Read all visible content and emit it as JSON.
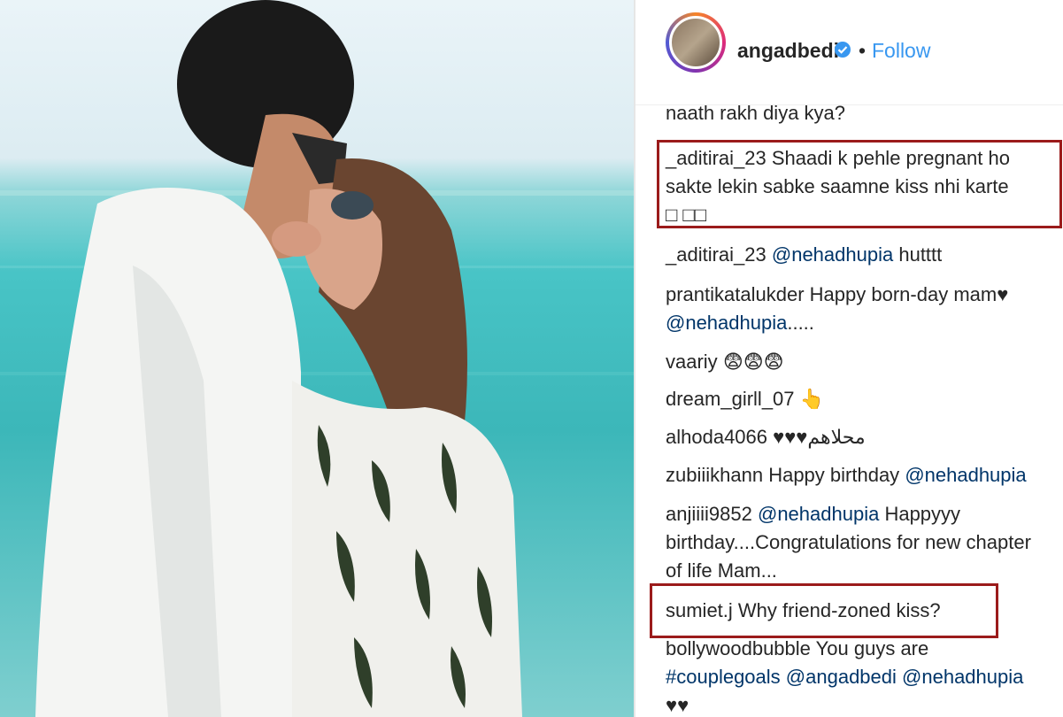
{
  "post": {
    "username": "angadbedi",
    "separator": "•",
    "follow_label": "Follow"
  },
  "comments": [
    {
      "text": "naath rakh diya kya?"
    },
    {
      "user": "_aditirai_23",
      "text": "Shaadi k pehle pregnant ho sakte lekin sabke saamne kiss nhi karte □ □□"
    },
    {
      "user": "_aditirai_23",
      "mention": "@nehadhupia",
      "text": "hutttt"
    },
    {
      "user": "prantikatalukder",
      "text": "Happy born-day mam♥",
      "mention2": "@nehadhupia",
      "text2": "....."
    },
    {
      "user": "vaariy",
      "text": "😨😨😨"
    },
    {
      "user": "dream_girll_07",
      "text": "👆"
    },
    {
      "user": "alhoda4066",
      "text": "♥♥♥محلاهم"
    },
    {
      "user": "zubiiikhann",
      "text": "Happy birthday",
      "mention": "@nehadhupia"
    },
    {
      "user": "anjiiii9852",
      "mention": "@nehadhupia",
      "text": "Happyyy birthday....Congratulations for new chapter of life Mam..."
    },
    {
      "user": "sumiet.j",
      "text": "Why friend-zoned kiss?"
    },
    {
      "user": "bollywoodbubble",
      "text": "You guys are",
      "mention": "#couplegoals",
      "mention2": "@angadbedi",
      "mention3": "@nehadhupia",
      "text2": "♥♥"
    }
  ],
  "colors": {
    "highlight_border": "#9b1b1b",
    "link": "#003569",
    "follow": "#3897f0"
  }
}
